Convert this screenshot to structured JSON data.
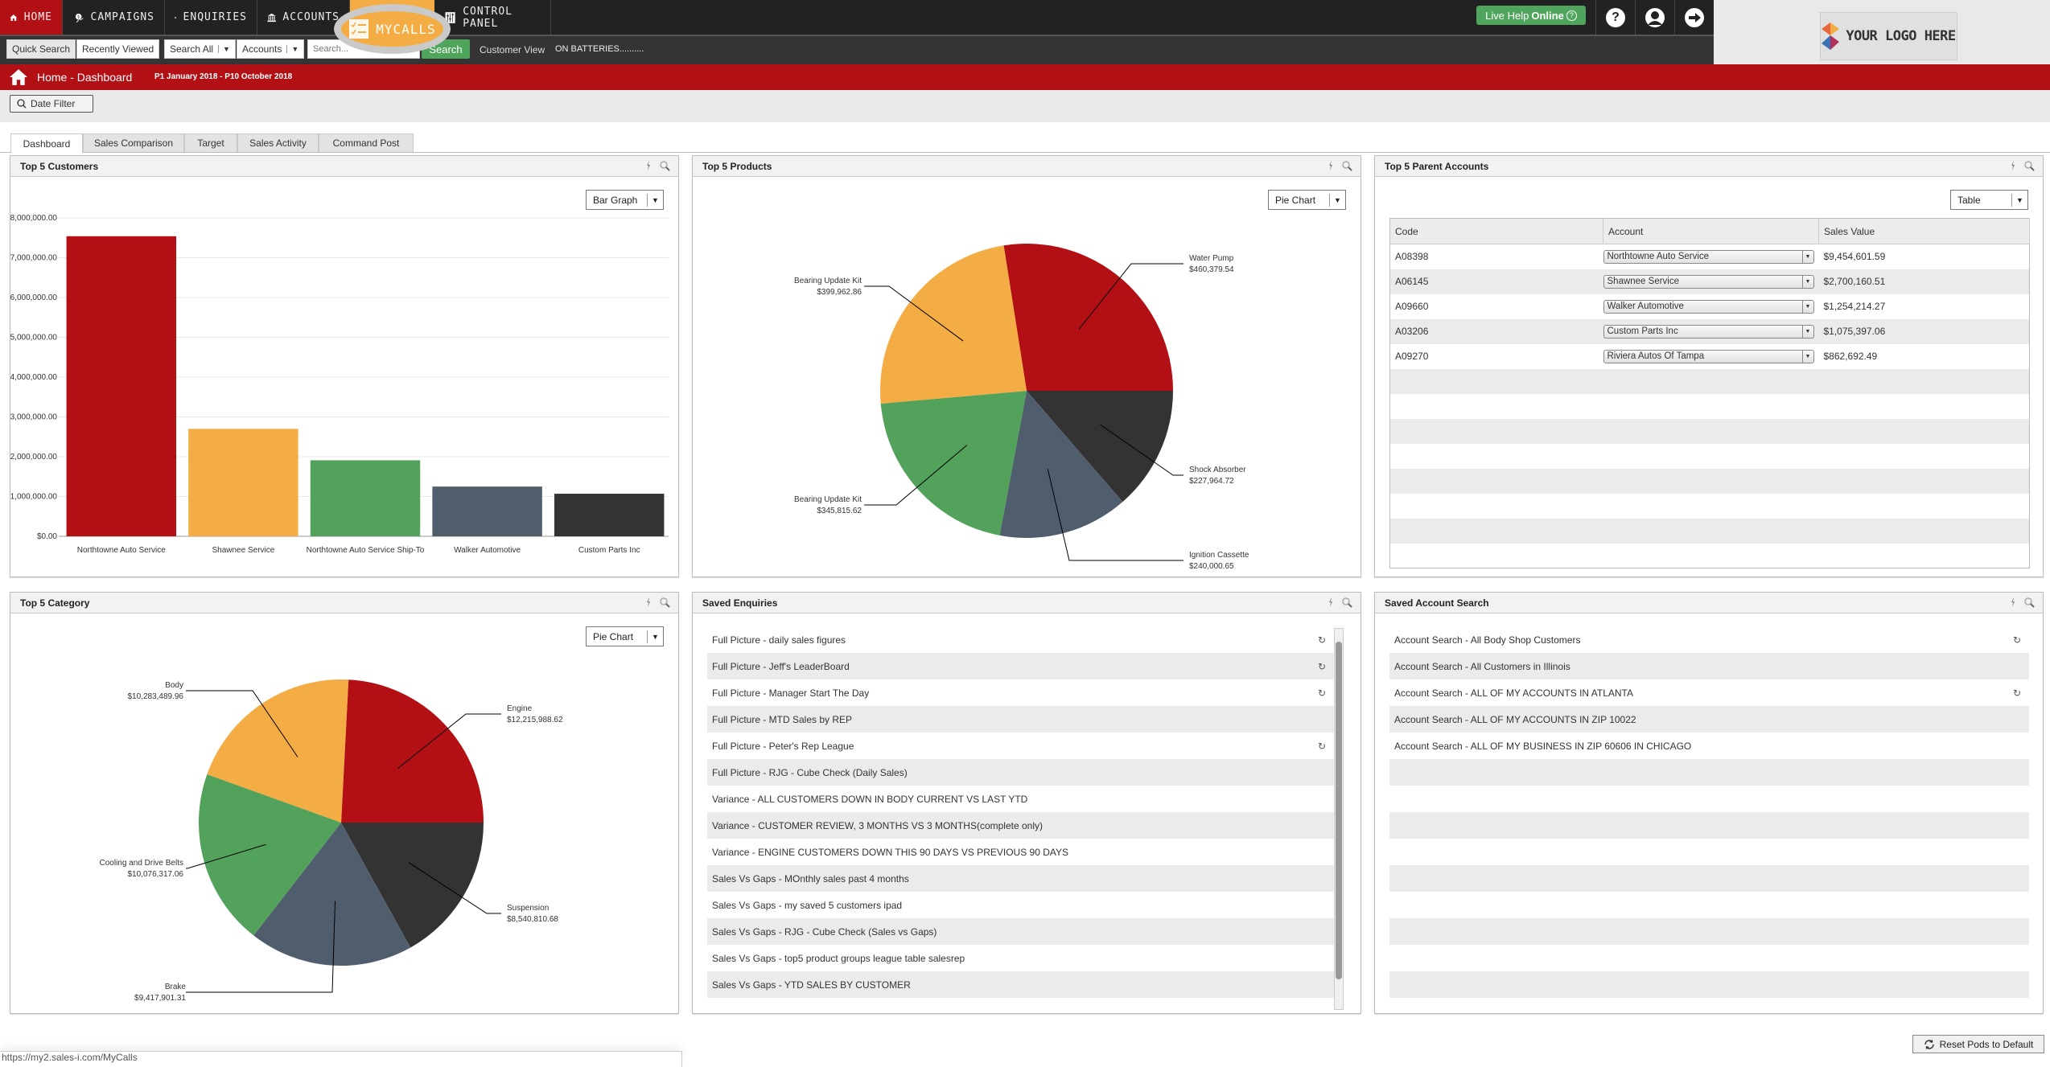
{
  "nav": {
    "items": [
      {
        "label": "HOME",
        "icon": "home-icon"
      },
      {
        "label": "CAMPAIGNS",
        "icon": "campaigns-icon"
      },
      {
        "label": "ENQUIRIES",
        "icon": "enquiries-icon"
      },
      {
        "label": "ACCOUNTS",
        "icon": "accounts-icon"
      },
      {
        "label": "MYCALLS",
        "icon": "mycalls-checklist-icon"
      },
      {
        "label": "CONTROL PANEL",
        "icon": "control-panel-icon"
      }
    ],
    "live_help_prefix": "Live Help",
    "live_help_status": "Online",
    "help_icon_glyph": "?",
    "logo_text": "YOUR LOGO HERE"
  },
  "search": {
    "quick_search": "Quick Search",
    "recently_viewed": "Recently Viewed",
    "scope": "Search All",
    "type": "Accounts",
    "placeholder": "Search...",
    "button": "Search",
    "customer_view": "Customer View",
    "ticker": "ON BATTERIES.........."
  },
  "header": {
    "breadcrumb": "Home - Dashboard",
    "period": "P1 January 2018 - P10 October 2018",
    "date_filter": "Date Filter"
  },
  "tabs": [
    "Dashboard",
    "Sales Comparison",
    "Target",
    "Sales Activity",
    "Command Post"
  ],
  "pods": {
    "customers": {
      "title": "Top 5 Customers",
      "view": "Bar Graph"
    },
    "products": {
      "title": "Top 5 Products",
      "view": "Pie Chart"
    },
    "parents": {
      "title": "Top 5 Parent Accounts",
      "view": "Table",
      "columns": [
        "Code",
        "Account",
        "Sales Value"
      ],
      "rows": [
        {
          "code": "A08398",
          "account": "Northtowne Auto Service",
          "value": "$9,454,601.59"
        },
        {
          "code": "A06145",
          "account": "Shawnee Service",
          "value": "$2,700,160.51"
        },
        {
          "code": "A09660",
          "account": "Walker Automotive",
          "value": "$1,254,214.27"
        },
        {
          "code": "A03206",
          "account": "Custom Parts Inc",
          "value": "$1,075,397.06"
        },
        {
          "code": "A09270",
          "account": "Riviera Autos Of Tampa",
          "value": "$862,692.49"
        }
      ],
      "empty_rows": 8
    },
    "category": {
      "title": "Top 5 Category",
      "view": "Pie Chart"
    },
    "enquiries": {
      "title": "Saved Enquiries",
      "items": [
        {
          "label": "Full Picture - daily sales figures",
          "refresh": true
        },
        {
          "label": "Full Picture - Jeff's LeaderBoard",
          "refresh": true
        },
        {
          "label": "Full Picture - Manager Start The Day",
          "refresh": true
        },
        {
          "label": "Full Picture - MTD Sales by REP",
          "refresh": false
        },
        {
          "label": "Full Picture - Peter's Rep League",
          "refresh": true
        },
        {
          "label": "Full Picture - RJG - Cube Check (Daily Sales)",
          "refresh": false
        },
        {
          "label": "Variance - ALL CUSTOMERS DOWN IN BODY CURRENT VS LAST YTD",
          "refresh": false
        },
        {
          "label": "Variance - CUSTOMER REVIEW, 3 MONTHS VS 3 MONTHS(complete only)",
          "refresh": false
        },
        {
          "label": "Variance - ENGINE CUSTOMERS DOWN THIS 90 DAYS VS PREVIOUS 90 DAYS",
          "refresh": false
        },
        {
          "label": "Sales Vs Gaps - MOnthly sales past 4 months",
          "refresh": false
        },
        {
          "label": "Sales Vs Gaps - my saved 5 customers ipad",
          "refresh": false
        },
        {
          "label": "Sales Vs Gaps - RJG - Cube Check (Sales vs Gaps)",
          "refresh": false
        },
        {
          "label": "Sales Vs Gaps - top5 product groups league table salesrep",
          "refresh": false
        },
        {
          "label": "Sales Vs Gaps - YTD SALES BY CUSTOMER",
          "refresh": false
        }
      ]
    },
    "account_search": {
      "title": "Saved Account Search",
      "items": [
        {
          "label": "Account Search - All Body Shop Customers",
          "refresh": true
        },
        {
          "label": "Account Search - All Customers in Illinois",
          "refresh": false
        },
        {
          "label": "Account Search - ALL OF MY ACCOUNTS IN ATLANTA",
          "refresh": true
        },
        {
          "label": "Account Search - ALL OF MY ACCOUNTS IN ZIP 10022",
          "refresh": false
        },
        {
          "label": "Account Search - ALL OF MY BUSINESS IN ZIP 60606 IN CHICAGO",
          "refresh": false
        },
        {
          "label": "",
          "refresh": false
        },
        {
          "label": "",
          "refresh": false
        },
        {
          "label": "",
          "refresh": false
        },
        {
          "label": "",
          "refresh": false
        },
        {
          "label": "",
          "refresh": false
        },
        {
          "label": "",
          "refresh": false
        },
        {
          "label": "",
          "refresh": false
        },
        {
          "label": "",
          "refresh": false
        },
        {
          "label": "",
          "refresh": false
        }
      ]
    }
  },
  "footer": {
    "status_url": "https://my2.sales-i.com/MyCalls",
    "reset_pods": "Reset Pods to Default"
  },
  "colors": {
    "brand_red": "#b31015",
    "orange": "#f4ac44",
    "green": "#52a25b",
    "slate": "#4f5d6d",
    "dark": "#333333"
  },
  "chart_data": [
    {
      "type": "bar",
      "title": "Top 5 Customers",
      "categories": [
        "Northtowne Auto Service",
        "Shawnee Service",
        "Northtowne Auto Service Ship-To",
        "Walker Automotive",
        "Custom Parts Inc"
      ],
      "values": [
        7540000,
        2700000,
        1910000,
        1250000,
        1070000
      ],
      "colors": [
        "#b31015",
        "#f4ac44",
        "#52a25b",
        "#4f5d6d",
        "#333333"
      ],
      "ylim": [
        0,
        8000000
      ],
      "yticks": [
        "$0.00",
        "$1,000,000.00",
        "$2,000,000.00",
        "$3,000,000.00",
        "$4,000,000.00",
        "$5,000,000.00",
        "$6,000,000.00",
        "$7,000,000.00",
        "$8,000,000.00"
      ],
      "xlabel": "",
      "ylabel": "",
      "grid": true
    },
    {
      "type": "pie",
      "title": "Top 5 Products",
      "labels": [
        "Water Pump",
        "Shock Absorber",
        "Ignition Cassette",
        "Bearing Update Kit",
        "Bearing Update Kit"
      ],
      "value_labels": [
        "$460,379.54",
        "$227,964.72",
        "$240,000.65",
        "$345,815.62",
        "$399,962.86"
      ],
      "values": [
        460379.54,
        227964.72,
        240000.65,
        345815.62,
        399962.86
      ],
      "colors": [
        "#b31015",
        "#333333",
        "#4f5d6d",
        "#52a25b",
        "#f4ac44"
      ]
    },
    {
      "type": "pie",
      "title": "Top 5 Category",
      "labels": [
        "Engine",
        "Suspension",
        "Brake",
        "Cooling and Drive Belts",
        "Body"
      ],
      "value_labels": [
        "$12,215,988.62",
        "$8,540,810.68",
        "$9,417,901.31",
        "$10,076,317.06",
        "$10,283,489.96"
      ],
      "values": [
        12215988.62,
        8540810.68,
        9417901.31,
        10076317.06,
        10283489.96
      ],
      "colors": [
        "#b31015",
        "#333333",
        "#4f5d6d",
        "#52a25b",
        "#f4ac44"
      ]
    }
  ]
}
